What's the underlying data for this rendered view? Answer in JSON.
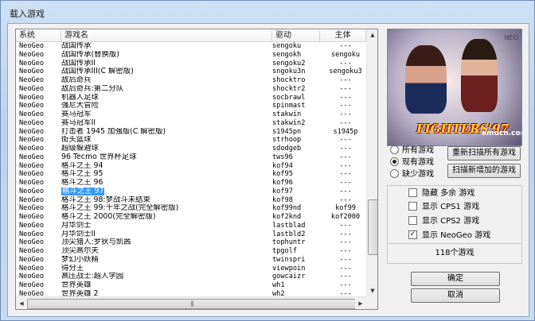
{
  "window": {
    "title": "载入游戏"
  },
  "columns": [
    "系统",
    "游戏名",
    "驱动",
    "主体"
  ],
  "games": [
    [
      "NeoGeo",
      "战国传承",
      "sengoku",
      "---"
    ],
    [
      "NeoGeo",
      "战国传承(替换版)",
      "sengokh",
      "sengoku"
    ],
    [
      "NeoGeo",
      "战国传承II",
      "sengoku2",
      "---"
    ],
    [
      "NeoGeo",
      "战国传承III(C 解密版)",
      "sngoku3n",
      "sengoku3"
    ],
    [
      "NeoGeo",
      "敌后奇兵",
      "shocktro",
      "---"
    ],
    [
      "NeoGeo",
      "敌后奇兵:第二分队",
      "shocktr2",
      "---"
    ],
    [
      "NeoGeo",
      "机器人足球",
      "socbrawl",
      "---"
    ],
    [
      "NeoGeo",
      "强尼大冒险",
      "spinmast",
      "---"
    ],
    [
      "NeoGeo",
      "赛马冠军",
      "stakwin",
      "---"
    ],
    [
      "NeoGeo",
      "赛马冠军II",
      "stakwin2",
      "---"
    ],
    [
      "NeoGeo",
      "打击者 1945 加强版(C 解密版)",
      "s1945pn",
      "s1945p"
    ],
    [
      "NeoGeo",
      "街头篮球",
      "strhoop",
      "---"
    ],
    [
      "NeoGeo",
      "超级躲避球",
      "sdodgeb",
      "---"
    ],
    [
      "NeoGeo",
      "96 Tecmo 世界杯足球",
      "tws96",
      "---"
    ],
    [
      "NeoGeo",
      "格斗之王 94",
      "kof94",
      "---"
    ],
    [
      "NeoGeo",
      "格斗之王 95",
      "kof95",
      "---"
    ],
    [
      "NeoGeo",
      "格斗之王 96",
      "kof96",
      "---"
    ],
    [
      "NeoGeo",
      "格斗之王 97",
      "kof97",
      "---"
    ],
    [
      "NeoGeo",
      "格斗之王 98:梦战斗未结束",
      "kof98",
      "---"
    ],
    [
      "NeoGeo",
      "格斗之王 99:千年之战(完全解密版)",
      "kof99nd",
      "kof99"
    ],
    [
      "NeoGeo",
      "格斗之王 2000(完全解密版)",
      "kof2knd",
      "kof2000"
    ],
    [
      "NeoGeo",
      "月华剑士",
      "lastblad",
      "---"
    ],
    [
      "NeoGeo",
      "月华剑士II",
      "lastbld2",
      "---"
    ],
    [
      "NeoGeo",
      "顶尖猎人:罗狄与凯茜",
      "tophuntr",
      "---"
    ],
    [
      "NeoGeo",
      "顶尖高尔夫",
      "tpgolf",
      "---"
    ],
    [
      "NeoGeo",
      "梦幻小妖精",
      "twinspri",
      "---"
    ],
    [
      "NeoGeo",
      "得分王",
      "viewpoin",
      "---"
    ],
    [
      "NeoGeo",
      "高压战士:超人学园",
      "gowcaizr",
      "---"
    ],
    [
      "NeoGeo",
      "世界英雄",
      "wh1",
      "---"
    ],
    [
      "NeoGeo",
      "世界英雄 2",
      "wh2",
      "---"
    ]
  ],
  "selected_index": 17,
  "preview": {
    "logo": "FIGHTERS'97",
    "watermark": "emucn.com",
    "corner": "NEO"
  },
  "filters": {
    "options": [
      "所有游戏",
      "现有游戏",
      "缺少游戏"
    ],
    "selected": 1
  },
  "buttons": {
    "rescan_all": "重新扫描所有游戏",
    "scan_new": "扫描新增加的游戏",
    "ok": "确定",
    "cancel": "取消"
  },
  "display_options": [
    {
      "label": "隐藏 多余 游戏",
      "checked": false
    },
    {
      "label": "显示 CPS1 游戏",
      "checked": false
    },
    {
      "label": "显示 CPS2 游戏",
      "checked": false
    },
    {
      "label": "显示 NeoGeo 游戏",
      "checked": true
    }
  ],
  "game_count_text": "118个游戏",
  "colors": {
    "selection": "#3399ff",
    "frame": "#bcd3ee"
  }
}
